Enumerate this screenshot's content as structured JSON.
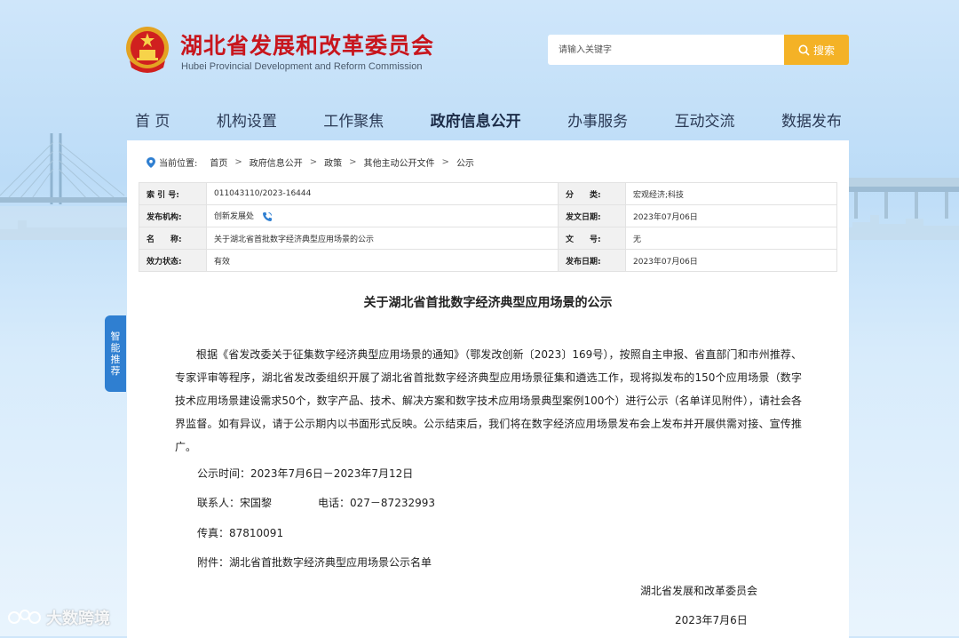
{
  "header": {
    "title_cn": "湖北省发展和改革委员会",
    "title_en": "Hubei Provincial Development and Reform Commission",
    "emblem_icon": "national-emblem-icon",
    "search": {
      "placeholder": "请输入关键字",
      "button_label": "搜索"
    }
  },
  "nav": {
    "items": [
      {
        "label": "首 页"
      },
      {
        "label": "机构设置"
      },
      {
        "label": "工作聚焦"
      },
      {
        "label": "政府信息公开"
      },
      {
        "label": "办事服务"
      },
      {
        "label": "互动交流"
      },
      {
        "label": "数据发布"
      }
    ],
    "active_index": 3
  },
  "breadcrumb": {
    "prefix": "当前位置:",
    "items": [
      "首页",
      "政府信息公开",
      "政策",
      "其他主动公开文件",
      "公示"
    ]
  },
  "info": {
    "index_label": "索 引 号:",
    "index_value": "011043110/2023-16444",
    "category_label": "分　　类:",
    "category_value": "宏观经济;科技",
    "publisher_label": "发布机构:",
    "publisher_value": "创新发展处",
    "doc_date_label": "发文日期:",
    "doc_date_value": "2023年07月06日",
    "name_label": "名　　称:",
    "name_value": "关于湖北省首批数字经济典型应用场景的公示",
    "doc_no_label": "文　　号:",
    "doc_no_value": "无",
    "status_label": "效力状态:",
    "status_value": "有效",
    "pub_date_label": "发布日期:",
    "pub_date_value": "2023年07月06日"
  },
  "article": {
    "title": "关于湖北省首批数字经济典型应用场景的公示",
    "paragraph": "根据《省发改委关于征集数字经济典型应用场景的通知》（鄂发改创新〔2023〕169号），按照自主申报、省直部门和市州推荐、专家评审等程序，湖北省发改委组织开展了湖北省首批数字经济典型应用场景征集和遴选工作，现将拟发布的150个应用场景（数字技术应用场景建设需求50个，数字产品、技术、解决方案和数字技术应用场景典型案例100个）进行公示（名单详见附件），请社会各界监督。如有异议，请于公示期内以书面形式反映。公示结束后，我们将在数字经济应用场景发布会上发布并开展供需对接、宣传推广。",
    "period": "公示时间：2023年7月6日－2023年7月12日",
    "contact": "联系人：宋国黎",
    "phone": "电话：027－87232993",
    "fax": "传真：87810091",
    "attachment": "附件：湖北省首批数字经济典型应用场景公示名单",
    "sign_org": "湖北省发展和改革委员会",
    "sign_date": "2023年7月6日"
  },
  "side_tab": {
    "chars": [
      "智",
      "能",
      "推",
      "荐"
    ]
  },
  "watermark": {
    "text": "大数跨境"
  },
  "colors": {
    "brand_red": "#c8161d",
    "accent_orange": "#f4b226",
    "tab_blue": "#2f7fd1"
  }
}
